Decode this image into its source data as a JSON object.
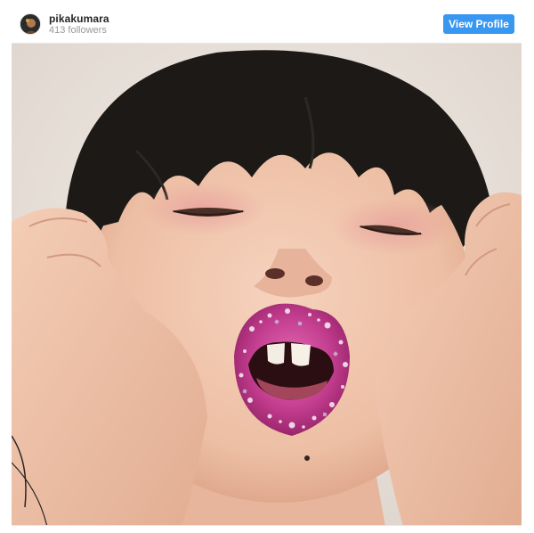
{
  "post": {
    "username": "pikakumara",
    "followers": "413 followers",
    "view_profile_label": "View Profile"
  },
  "colors": {
    "button_bg": "#3897f0",
    "lip": "#c03a8a",
    "background": "#e9e2dc",
    "skin": "#f0c4aa",
    "hair": "#1c1917"
  },
  "icons": [
    "avatar"
  ]
}
